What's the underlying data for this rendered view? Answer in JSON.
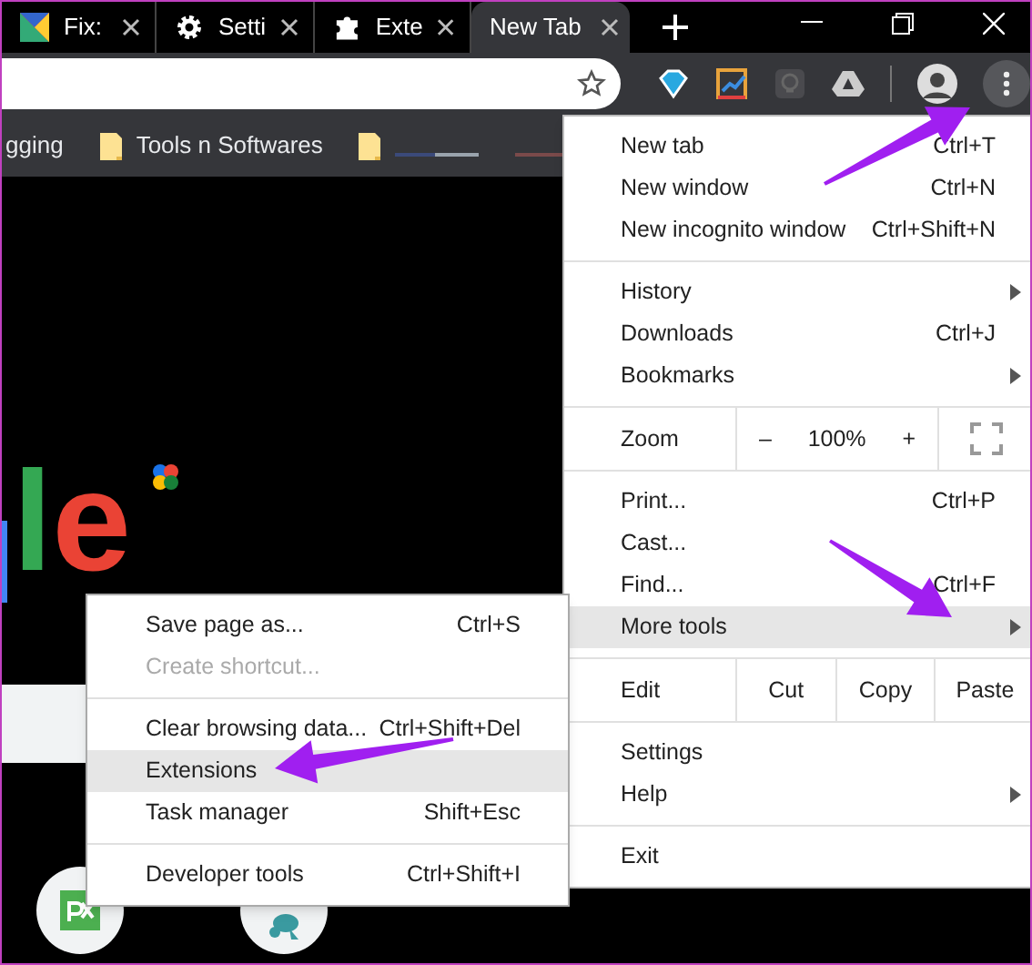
{
  "tabs": [
    {
      "title": "Fix:",
      "selected": false
    },
    {
      "title": "Setti",
      "selected": false
    },
    {
      "title": "Exte",
      "selected": false
    },
    {
      "title": "New Tab",
      "selected": true
    }
  ],
  "bookmarks": [
    {
      "kind": "text",
      "label": "gging"
    },
    {
      "kind": "folder",
      "label": "Tools n Softwares"
    },
    {
      "kind": "blurred"
    }
  ],
  "logo": {
    "letters": [
      {
        "char": "l",
        "color": "#34a853"
      },
      {
        "char": "e",
        "color": "#ea4335"
      }
    ]
  },
  "menu": {
    "sections": [
      {
        "items": [
          {
            "kind": "item",
            "label": "New tab",
            "shortcut": "Ctrl+T",
            "submenu": false,
            "highlighted": false,
            "disabled": false
          },
          {
            "kind": "item",
            "label": "New window",
            "shortcut": "Ctrl+N",
            "submenu": false,
            "highlighted": false,
            "disabled": false
          },
          {
            "kind": "item",
            "label": "New incognito window",
            "shortcut": "Ctrl+Shift+N",
            "submenu": false,
            "highlighted": false,
            "disabled": false
          }
        ]
      },
      {
        "items": [
          {
            "kind": "item",
            "label": "History",
            "submenu": true,
            "highlighted": false,
            "disabled": false
          },
          {
            "kind": "item",
            "label": "Downloads",
            "shortcut": "Ctrl+J",
            "submenu": false,
            "highlighted": false,
            "disabled": false
          },
          {
            "kind": "item",
            "label": "Bookmarks",
            "submenu": true,
            "highlighted": false,
            "disabled": false
          }
        ]
      },
      {
        "items": [
          {
            "kind": "zoom",
            "label": "Zoom",
            "minus": "–",
            "value": "100%",
            "plus": "+"
          }
        ]
      },
      {
        "items": [
          {
            "kind": "item",
            "label": "Print...",
            "shortcut": "Ctrl+P",
            "submenu": false,
            "highlighted": false,
            "disabled": false
          },
          {
            "kind": "item",
            "label": "Cast...",
            "submenu": false,
            "highlighted": false,
            "disabled": false
          },
          {
            "kind": "item",
            "label": "Find...",
            "shortcut": "Ctrl+F",
            "submenu": false,
            "highlighted": false,
            "disabled": false
          },
          {
            "kind": "item",
            "label": "More tools",
            "submenu": true,
            "highlighted": true,
            "disabled": false
          }
        ]
      },
      {
        "items": [
          {
            "kind": "edit",
            "label": "Edit",
            "buttons": [
              "Cut",
              "Copy",
              "Paste"
            ]
          }
        ]
      },
      {
        "items": [
          {
            "kind": "item",
            "label": "Settings",
            "submenu": false,
            "highlighted": false,
            "disabled": false
          },
          {
            "kind": "item",
            "label": "Help",
            "submenu": true,
            "highlighted": false,
            "disabled": false
          }
        ]
      },
      {
        "items": [
          {
            "kind": "item",
            "label": "Exit",
            "submenu": false,
            "highlighted": false,
            "disabled": false
          }
        ]
      }
    ]
  },
  "submenu": {
    "sections": [
      {
        "items": [
          {
            "kind": "item",
            "label": "Save page as...",
            "shortcut": "Ctrl+S",
            "submenu": false,
            "highlighted": false,
            "disabled": false
          },
          {
            "kind": "item",
            "label": "Create shortcut...",
            "submenu": false,
            "highlighted": false,
            "disabled": true
          }
        ]
      },
      {
        "items": [
          {
            "kind": "item",
            "label": "Clear browsing data...",
            "shortcut": "Ctrl+Shift+Del",
            "submenu": false,
            "highlighted": false,
            "disabled": false
          },
          {
            "kind": "item",
            "label": "Extensions",
            "submenu": false,
            "highlighted": true,
            "disabled": false
          },
          {
            "kind": "item",
            "label": "Task manager",
            "shortcut": "Shift+Esc",
            "submenu": false,
            "highlighted": false,
            "disabled": false
          }
        ]
      },
      {
        "items": [
          {
            "kind": "item",
            "label": "Developer tools",
            "shortcut": "Ctrl+Shift+I",
            "submenu": false,
            "highlighted": false,
            "disabled": false
          }
        ]
      }
    ]
  }
}
